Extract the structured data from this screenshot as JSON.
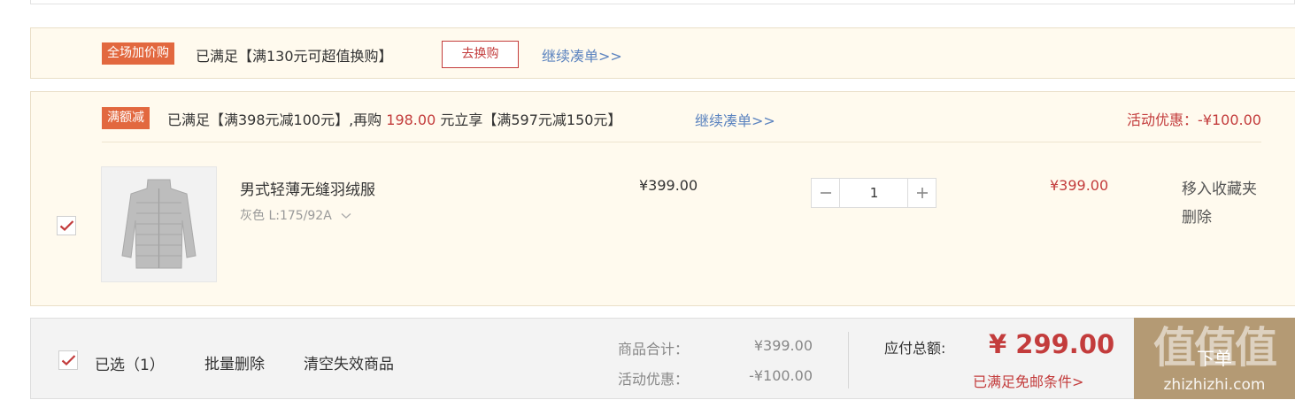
{
  "top_promo": {
    "tag": "全场加价购",
    "text": "已满足【满130元可超值换购】",
    "button": "去换购",
    "link": "继续凑单>>"
  },
  "group": {
    "tag": "满额减",
    "text_before": "已满足【满398元减100元】,再购",
    "extra_amount": "198.00",
    "text_after": "元立享【满597元减150元】",
    "link": "继续凑单>>",
    "discount": "活动优惠：-¥100.00"
  },
  "item": {
    "checked": true,
    "name": "男式轻薄无缝羽绒服",
    "spec": "灰色 L:175/92A",
    "unit_price": "¥399.00",
    "quantity": "1",
    "subtotal": "¥399.00",
    "action_favorite": "移入收藏夹",
    "action_delete": "删除",
    "image_color": "#b9b9b9"
  },
  "footer": {
    "selected": "已选（1）",
    "batch_delete": "批量删除",
    "clear_invalid": "清空失效商品",
    "goods_total_label": "商品合计：",
    "goods_total": "¥399.00",
    "discount_label": "活动优惠：",
    "discount": "-¥100.00",
    "pay_label": "应付总额:",
    "pay_total": "¥ 299.00",
    "shipping": "已满足免邮条件>",
    "checkout": "下单",
    "watermark_main": "值值值",
    "watermark_sub": "zhizhizhi.com"
  },
  "colors": {
    "accent_red": "#c33c3c",
    "tag_orange": "#e2683f",
    "link_blue": "#5b83bf",
    "panel_bg": "#fffaee",
    "checkout_bg": "#b49a74"
  },
  "icons": {
    "checkbox": "checkmark-icon",
    "minus": "minus-icon",
    "plus": "plus-icon",
    "spec_dropdown": "chevron-down-icon"
  }
}
